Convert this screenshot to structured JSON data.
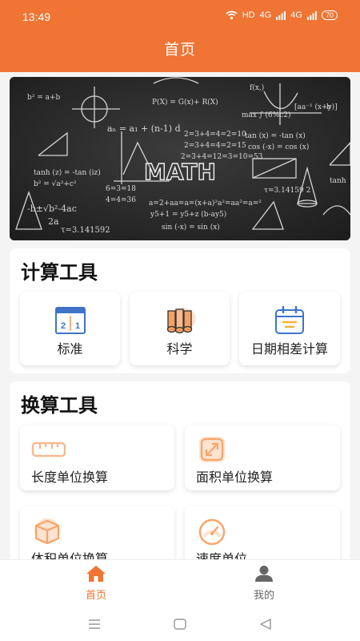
{
  "status_bar": {
    "time": "13:49",
    "network": "HD",
    "signal_1": "4G",
    "signal_2": "4G",
    "battery": "70"
  },
  "header": {
    "title": "首页"
  },
  "banner": {
    "board_text": "MATH",
    "icon": "math-blackboard-image"
  },
  "calc_tools": {
    "title": "计算工具",
    "items": [
      {
        "label": "标准",
        "icon": "standard-calculator-icon"
      },
      {
        "label": "科学",
        "icon": "science-scroll-icon"
      },
      {
        "label": "日期相差计算",
        "icon": "calendar-icon"
      }
    ]
  },
  "conversion_tools": {
    "title": "换算工具",
    "items": [
      {
        "label": "长度单位换算",
        "icon": "ruler-icon"
      },
      {
        "label": "面积单位换算",
        "icon": "area-icon"
      },
      {
        "label": "体积单位换算",
        "icon": "volume-box-icon"
      },
      {
        "label": "速度单位",
        "icon": "speedometer-icon"
      }
    ]
  },
  "tab_bar": {
    "items": [
      {
        "label": "首页",
        "icon": "home-icon",
        "active": true
      },
      {
        "label": "我的",
        "icon": "user-icon",
        "active": false
      }
    ]
  },
  "colors": {
    "accent": "#f07434",
    "icon_orange": "#f7b98e",
    "icon_blue": "#3f73c9",
    "tab_inactive": "#666666"
  }
}
